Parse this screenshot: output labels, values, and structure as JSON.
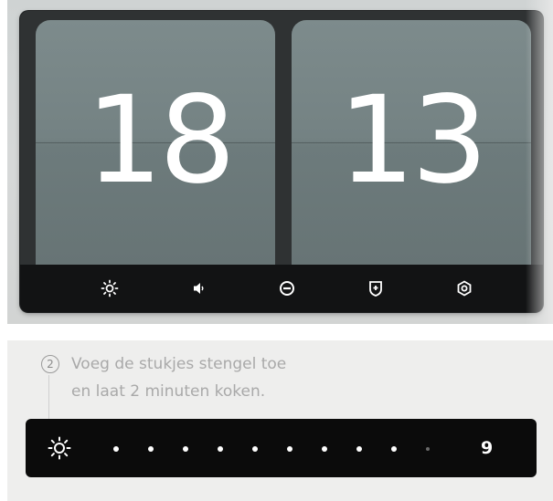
{
  "clock": {
    "hours": "18",
    "minutes": "13"
  },
  "toolbar": {
    "icons": [
      "brightness-icon",
      "volume-icon",
      "minus-circle-icon",
      "alarm-shield-icon",
      "settings-icon"
    ]
  },
  "recipe_step": {
    "number": "2",
    "line1": "Voeg de stukjes stengel toe",
    "line2": "en laat 2 minuten koken."
  },
  "heat_slider": {
    "icon": "brightness-icon",
    "value": "9",
    "total_steps": 10,
    "active_steps": 9
  },
  "colors": {
    "flip_card": "#748283",
    "device_frame": "#2f3233",
    "toolbar": "#121314",
    "slider_bar": "#0b0b0b",
    "step_text": "#a9a9a9"
  }
}
